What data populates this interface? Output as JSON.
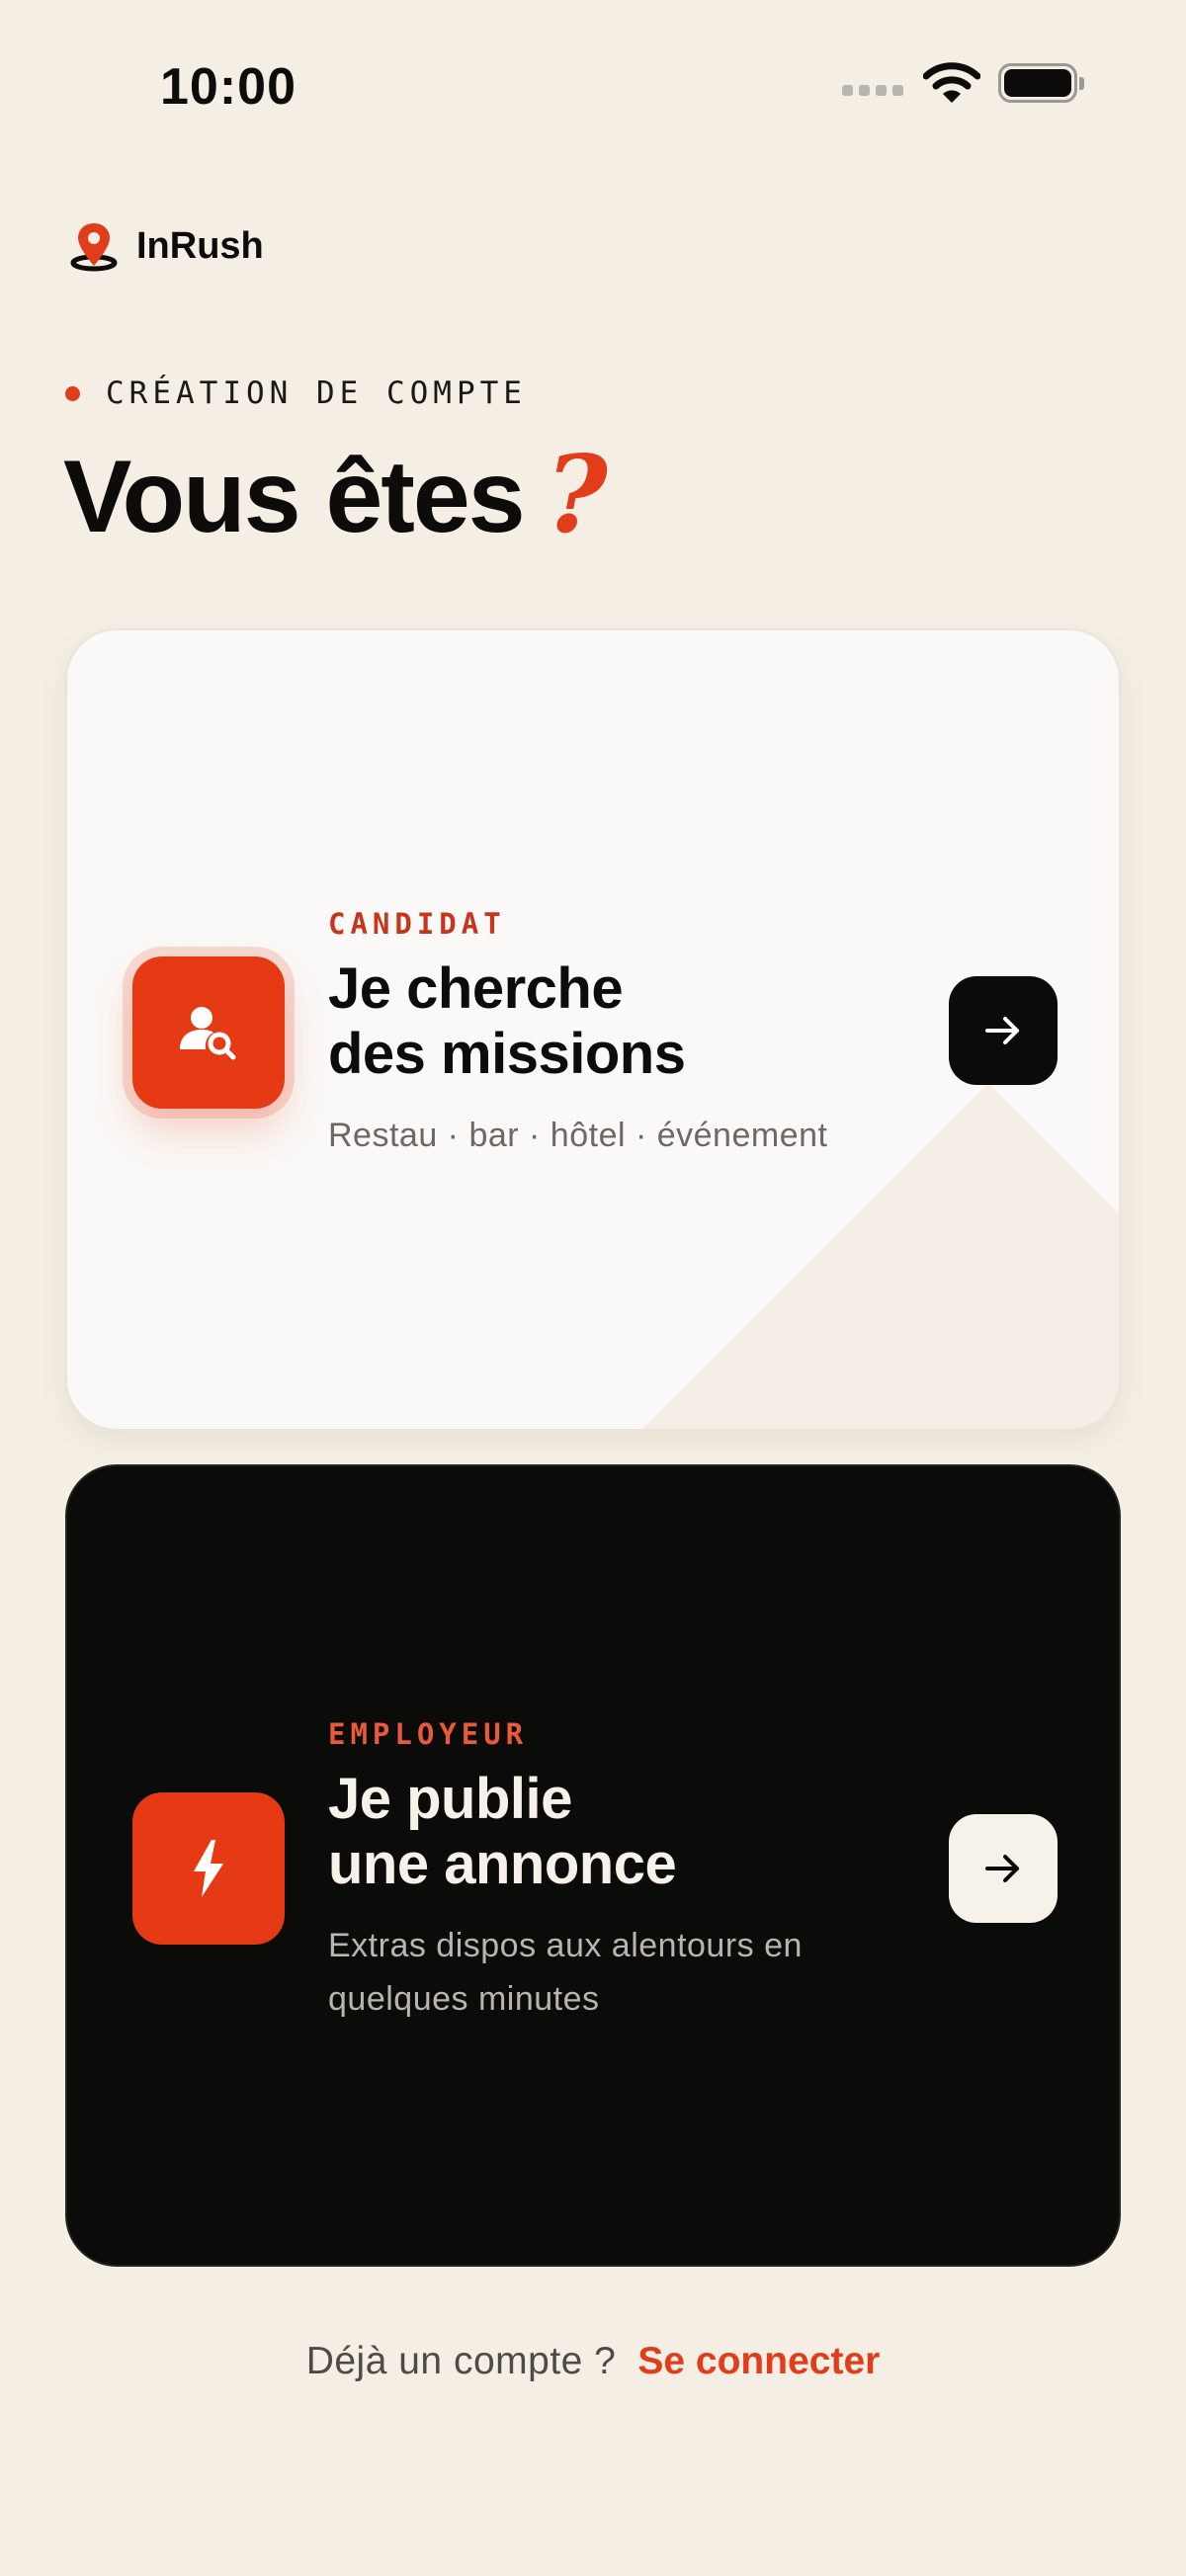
{
  "status_bar": {
    "time": "10:00"
  },
  "brand": {
    "name": "InRush"
  },
  "header": {
    "kicker": "CRÉATION DE COMPTE",
    "title": "Vous êtes",
    "title_mark": "?"
  },
  "cards": [
    {
      "role": "CANDIDAT",
      "title_line1": "Je cherche",
      "title_line2": "des missions",
      "subtitle": "Restau · bar · hôtel · événement",
      "icon": "user-search-icon"
    },
    {
      "role": "EMPLOYEUR",
      "title_line1": "Je publie",
      "title_line2": "une annonce",
      "subtitle_line1": "Extras dispos aux alentours en",
      "subtitle_line2": "quelques minutes",
      "icon": "lightning-bolt-icon"
    }
  ],
  "footer": {
    "question": "Déjà un compte ?",
    "link": "Se connecter"
  },
  "colors": {
    "background": "#F4EEE4",
    "accent": "#E23D1B",
    "dark": "#0B0B0A",
    "light_card": "#FAF9F7"
  }
}
